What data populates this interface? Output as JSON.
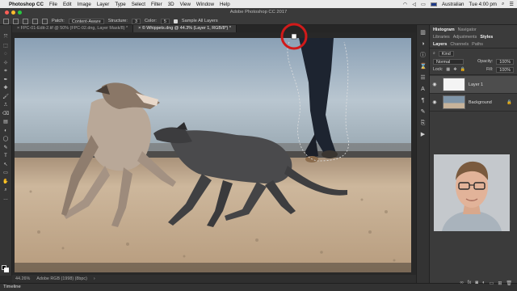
{
  "menubar": {
    "apple_glyph": "",
    "app_name": "Photoshop CC",
    "items": [
      "File",
      "Edit",
      "Image",
      "Layer",
      "Type",
      "Select",
      "Filter",
      "3D",
      "View",
      "Window",
      "Help"
    ],
    "input_source": "Australian",
    "clock": "Tue 4:00 pm"
  },
  "window": {
    "title": "Adobe Photoshop CC 2017"
  },
  "options": {
    "patch_label": "Patch:",
    "patch_value": "Content-Aware",
    "structure_label": "Structure:",
    "structure_value": "3",
    "color_label": "Color:",
    "color_value": "5",
    "sample_all_label": "Sample All Layers"
  },
  "tabs": [
    {
      "label": "FPC-01-Edit-2.tif @ 50% (FPC-02.dng, Layer Mask/8) *",
      "active": false
    },
    {
      "label": "© Whippets.dng @ 44.3% (Layer 1, RGB/8*) *",
      "active": true
    }
  ],
  "tools": [
    "⤧",
    "⬚",
    "◌",
    "⊹",
    "⌗",
    "✒",
    "✚",
    "🖌",
    "⎍",
    "⌫",
    "▤",
    "◐",
    "◯",
    "✎",
    "T",
    "↖",
    "▭",
    "✋",
    "⌕",
    "…"
  ],
  "status": {
    "zoom": "44.26%",
    "profile": "Adobe RGB (1998) (8bpc)"
  },
  "timeline": {
    "label": "Timeline"
  },
  "panels": {
    "top_tabs": [
      "Histogram",
      "Navigator"
    ],
    "mid_tabs": [
      "Libraries",
      "Adjustments",
      "Styles"
    ],
    "layer_tabs": [
      "Layers",
      "Channels",
      "Paths"
    ],
    "kind_label": "Kind",
    "blend_mode": "Normal",
    "opacity_label": "Opacity:",
    "opacity_value": "100%",
    "lock_label": "Lock:",
    "fill_label": "Fill:",
    "fill_value": "100%",
    "layers": [
      {
        "name": "Layer 1"
      },
      {
        "name": "Background"
      }
    ]
  },
  "colors": {
    "menubar_bg": "#e9e9e9",
    "app_bg": "#2b2b2b",
    "panel_bg": "#3b3b3b",
    "highlight_circle": "#d11a1a"
  }
}
